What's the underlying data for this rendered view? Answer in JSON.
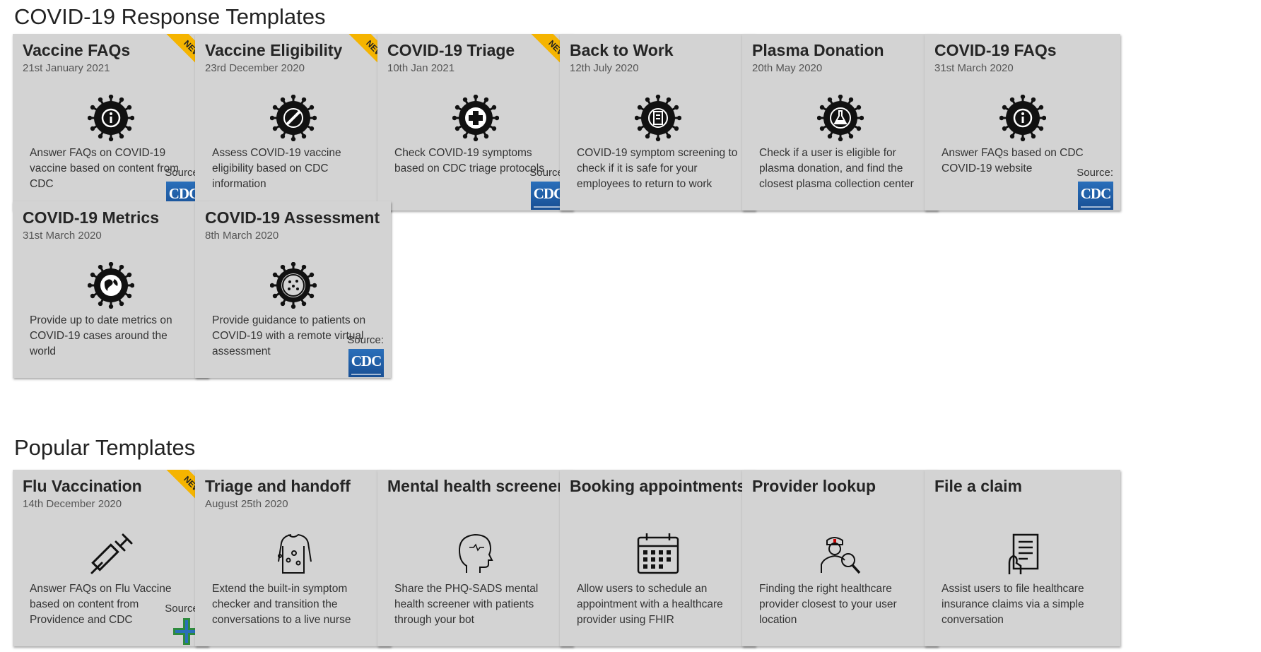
{
  "sections": {
    "covid_title": "COVID-19 Response Templates",
    "popular_title": "Popular Templates"
  },
  "badge_new": "NEW",
  "source_label": "Source:",
  "cdc_logo_text": "CDC",
  "covid_cards": [
    {
      "title": "Vaccine FAQs",
      "date": "21st January 2021",
      "desc": "Answer FAQs on COVID-19 vaccine based on content from CDC",
      "icon": "virus-info-icon",
      "new": true,
      "source": "cdc"
    },
    {
      "title": "Vaccine Eligibility",
      "date": "23rd December 2020",
      "desc": "Assess COVID-19 vaccine eligibility based on CDC information",
      "icon": "virus-syringe-icon",
      "new": true,
      "source": ""
    },
    {
      "title": "COVID-19 Triage",
      "date": "10th Jan 2021",
      "desc": "Check COVID-19 symptoms based on CDC triage protocols",
      "icon": "virus-medical-cross-icon",
      "new": true,
      "source": "cdc"
    },
    {
      "title": "Back to Work",
      "date": "12th July 2020",
      "desc": "COVID-19 symptom screening to check if it is safe for your employees to return to work",
      "icon": "virus-building-icon",
      "new": false,
      "source": ""
    },
    {
      "title": "Plasma Donation",
      "date": "20th May 2020",
      "desc": "Check if a user is eligible for plasma donation, and find the closest plasma collection center",
      "icon": "virus-flask-icon",
      "new": false,
      "source": ""
    },
    {
      "title": "COVID-19 FAQs",
      "date": "31st March 2020",
      "desc": "Answer FAQs based on CDC COVID-19 website",
      "icon": "virus-info-icon",
      "new": false,
      "source": "cdc"
    },
    {
      "title": "COVID-19 Metrics",
      "date": "31st March 2020",
      "desc": "Provide up to date metrics on COVID-19 cases around the world",
      "icon": "virus-globe-icon",
      "new": false,
      "source": ""
    },
    {
      "title": "COVID-19 Assessment",
      "date": "8th March 2020",
      "desc": "Provide guidance to patients on COVID-19 with a remote virtual assessment",
      "icon": "virus-icon",
      "new": false,
      "source": "cdc"
    }
  ],
  "popular_cards": [
    {
      "title": "Flu Vaccination",
      "date": "14th December 2020",
      "desc": "Answer FAQs on Flu Vaccine based on content from Providence and CDC",
      "icon": "syringe-icon",
      "new": true,
      "source": "providence"
    },
    {
      "title": "Triage and handoff",
      "date": "August 25th 2020",
      "desc": "Extend the built-in symptom checker and transition the conversations to a live nurse",
      "icon": "body-symptoms-icon",
      "new": false,
      "source": ""
    },
    {
      "title": "Mental health screener",
      "date": "",
      "desc": "Share the PHQ-SADS mental health screener with patients through your bot",
      "icon": "head-icon",
      "new": false,
      "source": ""
    },
    {
      "title": "Booking appointments",
      "date": "",
      "desc": "Allow users to schedule an appointment with a healthcare provider using FHIR",
      "icon": "calendar-icon",
      "new": false,
      "source": ""
    },
    {
      "title": "Provider lookup",
      "date": "",
      "desc": "Finding the right healthcare provider closest to your user location",
      "icon": "doctor-search-icon",
      "new": false,
      "source": ""
    },
    {
      "title": "File a claim",
      "date": "",
      "desc": "Assist users to file healthcare insurance claims via a simple conversation",
      "icon": "document-hand-icon",
      "new": false,
      "source": ""
    }
  ]
}
